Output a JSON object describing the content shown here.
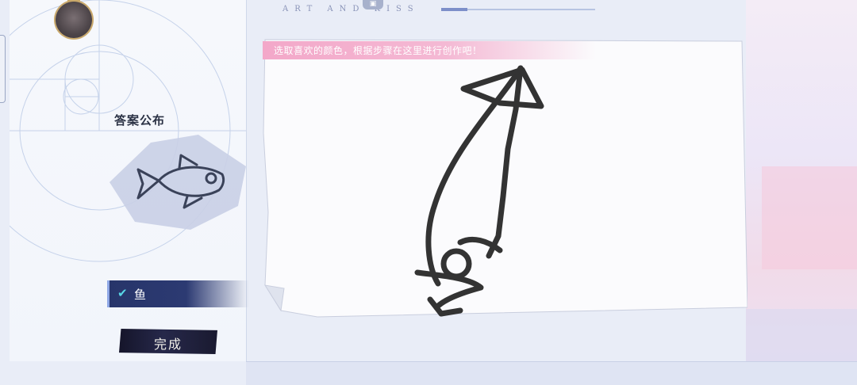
{
  "header": {
    "brand_text": "ART AND KISS",
    "progress": 0.17
  },
  "answer_panel": {
    "title": "答案公布",
    "answer_label": "鱼",
    "done_button": "完成"
  },
  "canvas": {
    "instruction": "选取喜欢的颜色，根据步骤在这里进行创作吧！"
  },
  "colors": {
    "accent_pink": "#f3a8c9",
    "tag_blue": "#27356a",
    "check_cyan": "#58d7e6",
    "stroke": "#333333"
  },
  "icons": {
    "check": "check-icon",
    "emblem": "emblem-icon"
  }
}
